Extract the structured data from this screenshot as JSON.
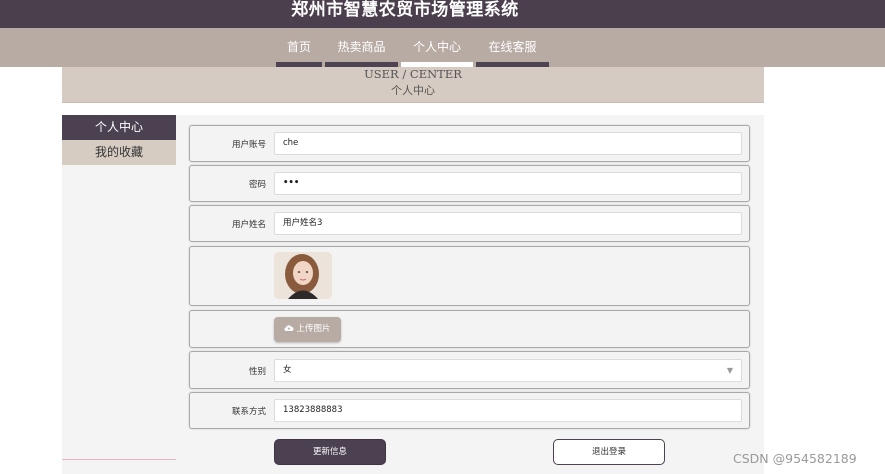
{
  "site": {
    "title": "郑州市智慧农贸市场管理系统"
  },
  "nav": {
    "items": [
      {
        "label": "首页",
        "active": false
      },
      {
        "label": "热卖商品",
        "active": false
      },
      {
        "label": "个人中心",
        "active": true
      },
      {
        "label": "在线客服",
        "active": false
      }
    ]
  },
  "banner": {
    "en": "USER / CENTER",
    "cn": "个人中心"
  },
  "sidebar": {
    "items": [
      {
        "label": "个人中心",
        "active": true
      },
      {
        "label": "我的收藏",
        "active": false
      }
    ]
  },
  "form": {
    "account": {
      "label": "用户账号",
      "value": "che"
    },
    "password": {
      "label": "密码",
      "value": "•••"
    },
    "name": {
      "label": "用户姓名",
      "value": "用户姓名3"
    },
    "upload": {
      "label": "上传图片",
      "icon": "cloud-upload-icon"
    },
    "gender": {
      "label": "性别",
      "value": "女"
    },
    "phone": {
      "label": "联系方式",
      "value": "13823888883"
    }
  },
  "actions": {
    "update_label": "更新信息",
    "logout_label": "退出登录"
  },
  "watermark": "CSDN @954582189",
  "colors": {
    "accent": "#4c4150",
    "nav_bg": "#b7aba4",
    "banner_bg": "#d6cbc2"
  }
}
